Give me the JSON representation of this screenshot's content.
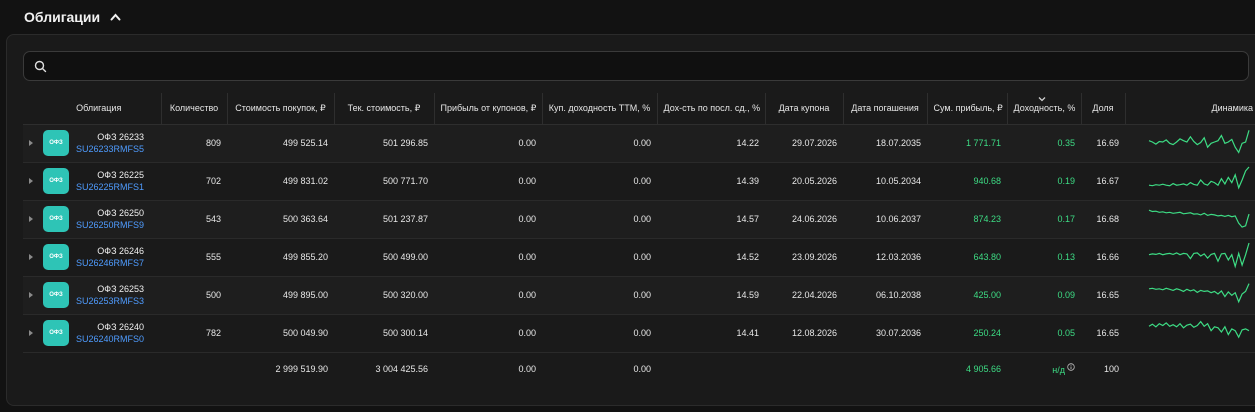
{
  "section": {
    "title": "Облигации"
  },
  "search": {
    "placeholder": ""
  },
  "columns": [
    "Облигация",
    "Количество",
    "Стоимость покупок, ₽",
    "Тек. стоимость, ₽",
    "Прибыль от купонов, ₽",
    "Куп. доходность TTM, %",
    "Дох-сть по посл. сд., %",
    "Дата купона",
    "Дата погашения",
    "Сум. прибыль, ₽",
    "Доходность, %",
    "Доля",
    "Динамика"
  ],
  "sort": {
    "column": "Доходность, %",
    "direction": "desc"
  },
  "logo_text": "ОФЗ",
  "rows": [
    {
      "name": "ОФЗ 26233",
      "isin": "SU26233RMFS5",
      "qty": "809",
      "purchase": "499 525.14",
      "current": "501 296.85",
      "coupon_profit": "0.00",
      "coupon_ttm": "0.00",
      "last_yield": "14.22",
      "coupon_date": "29.07.2026",
      "maturity": "18.07.2035",
      "total_profit": "1 771.71",
      "yield": "0.35",
      "share": "16.69",
      "spark": [
        0.55,
        0.5,
        0.42,
        0.52,
        0.5,
        0.58,
        0.45,
        0.4,
        0.5,
        0.62,
        0.55,
        0.5,
        0.7,
        0.52,
        0.4,
        0.48,
        0.66,
        0.3,
        0.45,
        0.5,
        0.55,
        0.75,
        0.45,
        0.5,
        0.6,
        0.3,
        0.1,
        0.45,
        0.5,
        0.95
      ]
    },
    {
      "name": "ОФЗ 26225",
      "isin": "SU26225RMFS1",
      "qty": "702",
      "purchase": "499 831.02",
      "current": "500 771.70",
      "coupon_profit": "0.00",
      "coupon_ttm": "0.00",
      "last_yield": "14.39",
      "coupon_date": "20.05.2026",
      "maturity": "10.05.2034",
      "total_profit": "940.68",
      "yield": "0.19",
      "share": "16.67",
      "spark": [
        0.3,
        0.28,
        0.32,
        0.3,
        0.34,
        0.3,
        0.28,
        0.36,
        0.3,
        0.32,
        0.35,
        0.3,
        0.4,
        0.33,
        0.3,
        0.5,
        0.35,
        0.3,
        0.45,
        0.4,
        0.3,
        0.55,
        0.35,
        0.6,
        0.4,
        0.7,
        0.2,
        0.5,
        0.85,
        1.0
      ]
    },
    {
      "name": "ОФЗ 26250",
      "isin": "SU26250RMFS9",
      "qty": "543",
      "purchase": "500 363.64",
      "current": "501 237.87",
      "coupon_profit": "0.00",
      "coupon_ttm": "0.00",
      "last_yield": "14.57",
      "coupon_date": "24.06.2026",
      "maturity": "10.06.2037",
      "total_profit": "874.23",
      "yield": "0.17",
      "share": "16.68",
      "spark": [
        0.8,
        0.75,
        0.76,
        0.72,
        0.74,
        0.7,
        0.72,
        0.68,
        0.7,
        0.72,
        0.66,
        0.68,
        0.7,
        0.65,
        0.66,
        0.62,
        0.68,
        0.6,
        0.64,
        0.62,
        0.58,
        0.6,
        0.56,
        0.6,
        0.55,
        0.58,
        0.3,
        0.15,
        0.2,
        0.65
      ]
    },
    {
      "name": "ОФЗ 26246",
      "isin": "SU26246RMFS7",
      "qty": "555",
      "purchase": "499 855.20",
      "current": "500 499.00",
      "coupon_profit": "0.00",
      "coupon_ttm": "0.00",
      "last_yield": "14.52",
      "coupon_date": "23.09.2026",
      "maturity": "12.03.2036",
      "total_profit": "643.80",
      "yield": "0.13",
      "share": "16.66",
      "spark": [
        0.55,
        0.58,
        0.56,
        0.6,
        0.55,
        0.58,
        0.6,
        0.56,
        0.62,
        0.55,
        0.6,
        0.58,
        0.4,
        0.6,
        0.62,
        0.5,
        0.58,
        0.42,
        0.56,
        0.6,
        0.3,
        0.58,
        0.6,
        0.35,
        0.55,
        0.1,
        0.6,
        0.15,
        0.55,
        1.0
      ]
    },
    {
      "name": "ОФЗ 26253",
      "isin": "SU26253RMFS3",
      "qty": "500",
      "purchase": "499 895.00",
      "current": "500 320.00",
      "coupon_profit": "0.00",
      "coupon_ttm": "0.00",
      "last_yield": "14.59",
      "coupon_date": "22.04.2026",
      "maturity": "06.10.2038",
      "total_profit": "425.00",
      "yield": "0.09",
      "share": "16.65",
      "spark": [
        0.7,
        0.72,
        0.68,
        0.7,
        0.66,
        0.72,
        0.68,
        0.64,
        0.7,
        0.66,
        0.6,
        0.68,
        0.62,
        0.66,
        0.56,
        0.64,
        0.6,
        0.62,
        0.55,
        0.6,
        0.5,
        0.62,
        0.4,
        0.58,
        0.45,
        0.55,
        0.2,
        0.5,
        0.6,
        0.9
      ]
    },
    {
      "name": "ОФЗ 26240",
      "isin": "SU26240RMFS0",
      "qty": "782",
      "purchase": "500 049.90",
      "current": "500 300.14",
      "coupon_profit": "0.00",
      "coupon_ttm": "0.00",
      "last_yield": "14.41",
      "coupon_date": "12.08.2026",
      "maturity": "30.07.2036",
      "total_profit": "250.24",
      "yield": "0.05",
      "share": "16.65",
      "spark": [
        0.72,
        0.8,
        0.7,
        0.82,
        0.75,
        0.85,
        0.72,
        0.78,
        0.7,
        0.82,
        0.66,
        0.76,
        0.8,
        0.68,
        0.75,
        0.9,
        0.72,
        0.82,
        0.55,
        0.7,
        0.66,
        0.5,
        0.7,
        0.4,
        0.62,
        0.55,
        0.3,
        0.58,
        0.62,
        0.55
      ]
    }
  ],
  "totals": {
    "purchase": "2 999 519.90",
    "current": "3 004 425.56",
    "coupon_profit": "0.00",
    "coupon_ttm": "0.00",
    "total_profit": "4 905.66",
    "yield": "н/д",
    "share": "100"
  },
  "colors": {
    "accent_green": "#3ddc84",
    "link_blue": "#4f9cff",
    "logo_teal": "#2ec4b6"
  }
}
